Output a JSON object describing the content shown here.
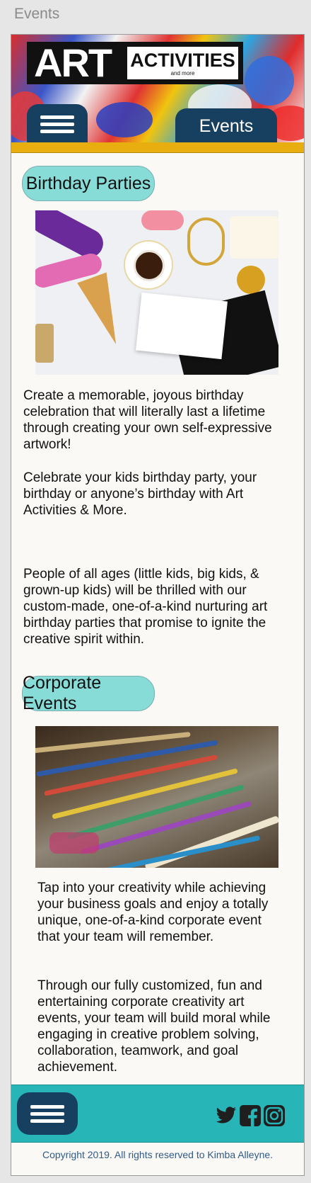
{
  "artboard": {
    "label": "Events"
  },
  "header": {
    "logo": {
      "art": "ART",
      "word": "ACTIVITIES",
      "tagline": "and more"
    },
    "menu_icon": "hamburger-menu-icon",
    "active_tab": "Events"
  },
  "sections": {
    "birthday": {
      "title": "Birthday Parties",
      "paragraphs": [
        "Create a memorable, joyous birthday celebration that will literally last a lifetime through creating your own self-expressive artwork!",
        "Celebrate your kids birthday party, your birthday or  anyone’s birthday with Art Activities & More.",
        "People of all ages (little kids, big kids, & grown-up kids) will be thrilled with our custom-made, one-of-a-kind nurturing art birthday parties that promise to ignite the creative spirit within."
      ]
    },
    "corporate": {
      "title": "Corporate Events",
      "paragraphs": [
        "Tap into your creativity while achieving your business goals and enjoy a totally unique, one-of-a-kind corporate event that your team will remember.",
        "Through our fully customized, fun and entertaining corporate creativity art events, your team will build moral while engaging in creative problem solving, collaboration, teamwork, and goal achievement."
      ]
    }
  },
  "footer": {
    "menu_icon": "hamburger-menu-icon",
    "social": [
      "twitter-icon",
      "facebook-icon",
      "instagram-icon"
    ],
    "copyright": "Copyright 2019. All rights reserved to Kimba Alleyne."
  },
  "colors": {
    "navy": "#173f5f",
    "teal": "#27b5b8",
    "pill": "#88dcd7",
    "gold": "#e8ae10",
    "copyright_text": "#2f5a86"
  }
}
